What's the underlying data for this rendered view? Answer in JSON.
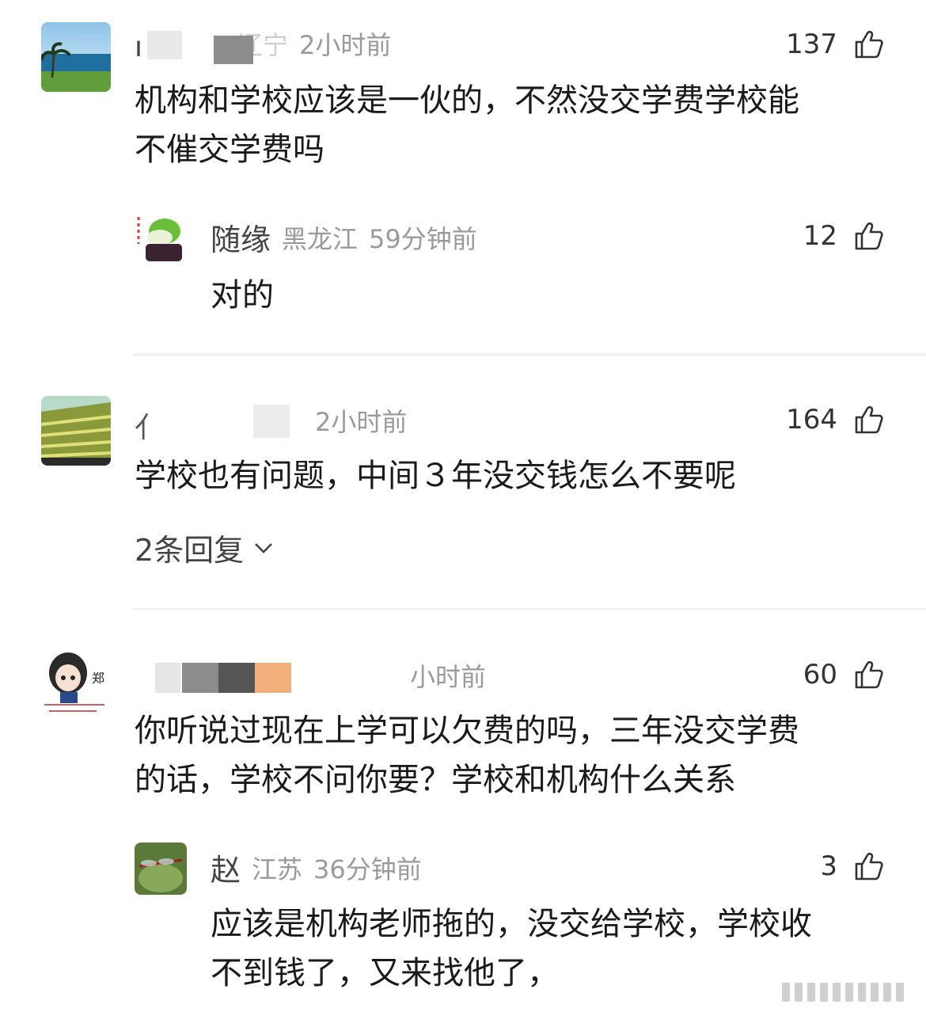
{
  "comments": [
    {
      "username": "",
      "location": "辽宁",
      "time": "2小时前",
      "likes": "137",
      "text_lines": [
        "机构和学校应该是一伙的，不然没交学费学校能",
        "不催交学费吗"
      ],
      "reply": {
        "username": "随缘",
        "location": "黑龙江",
        "time": "59分钟前",
        "likes": "12",
        "text": "对的"
      }
    },
    {
      "username": "",
      "location": "",
      "time": "2小时前",
      "likes": "164",
      "text_lines": [
        "学校也有问题，中间３年没交钱怎么不要呢"
      ],
      "replies_link": "2条回复"
    },
    {
      "username": "",
      "location": "",
      "time": "小时前",
      "likes": "60",
      "text_lines": [
        "你听说过现在上学可以欠费的吗，三年没交学费",
        "的话，学校不问你要？学校和机构什么关系"
      ],
      "reply": {
        "username": "赵",
        "location": "江苏",
        "time": "36分钟前",
        "likes": "3",
        "text_lines": [
          "应该是机构老师拖的，没交给学校，学校收",
          "不到钱了，又来找他了，"
        ]
      }
    }
  ],
  "avatar_seal": "郑",
  "icons": {
    "like": "thumbs-up-icon",
    "expand": "chevron-down-icon"
  },
  "colors": {
    "meta_gray": "#9a9a9a",
    "text": "#1a1a1a",
    "divider": "#eeeeee"
  }
}
